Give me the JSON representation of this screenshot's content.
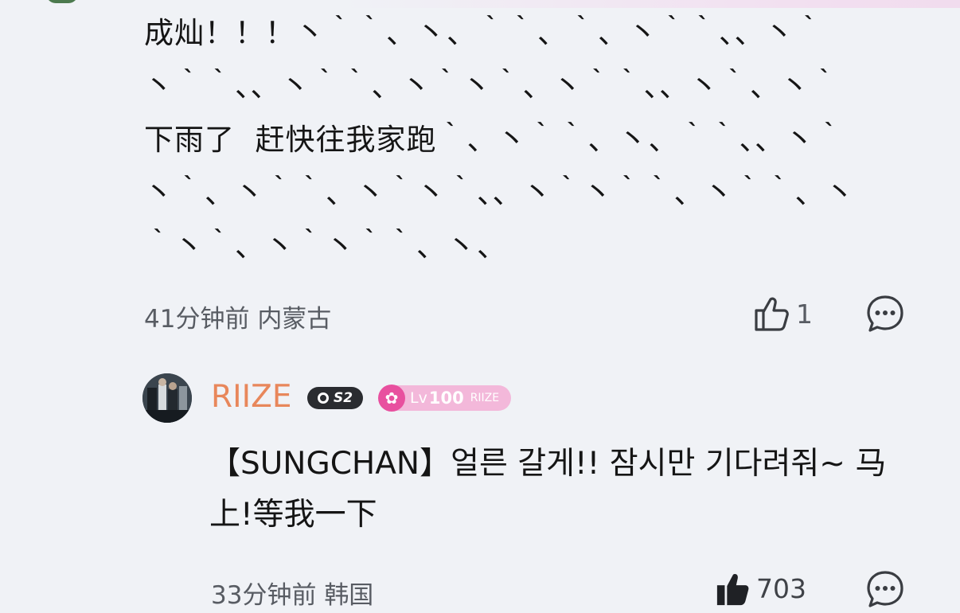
{
  "comments": [
    {
      "text": "成灿！！！丶｀｀、丶、｀｀、｀、丶｀｀、、丶｀\n丶｀｀、、丶｀｀、丶｀丶｀、丶｀｀、、丶｀、丶｀\n下雨了  赶快往我家跑｀、丶｀｀、丶、｀｀、、丶｀\n丶｀、丶｀｀、丶｀丶｀、、丶｀丶｀｀、丶｀｀、丶\n｀丶｀、丶｀丶｀｀、丶、",
      "time": "41分钟前",
      "location": "内蒙古",
      "likes": "1",
      "liked": false
    },
    {
      "username": "RIIZE",
      "s2_badge": "S2",
      "level_prefix": "Lv",
      "level": "100",
      "fan_group": "RIIZE",
      "text": "【SUNGCHAN】얼른 갈게!! 잠시만 기다려줘~ 马\n上!等我一下",
      "time": "33分钟前",
      "location": "韩国",
      "likes": "703",
      "liked": true
    }
  ],
  "colors": {
    "username": "#e8875b",
    "meta": "#585c63",
    "background": "#f0f2f6",
    "level_badge": "#f3b8da",
    "level_star": "#e8509f"
  }
}
